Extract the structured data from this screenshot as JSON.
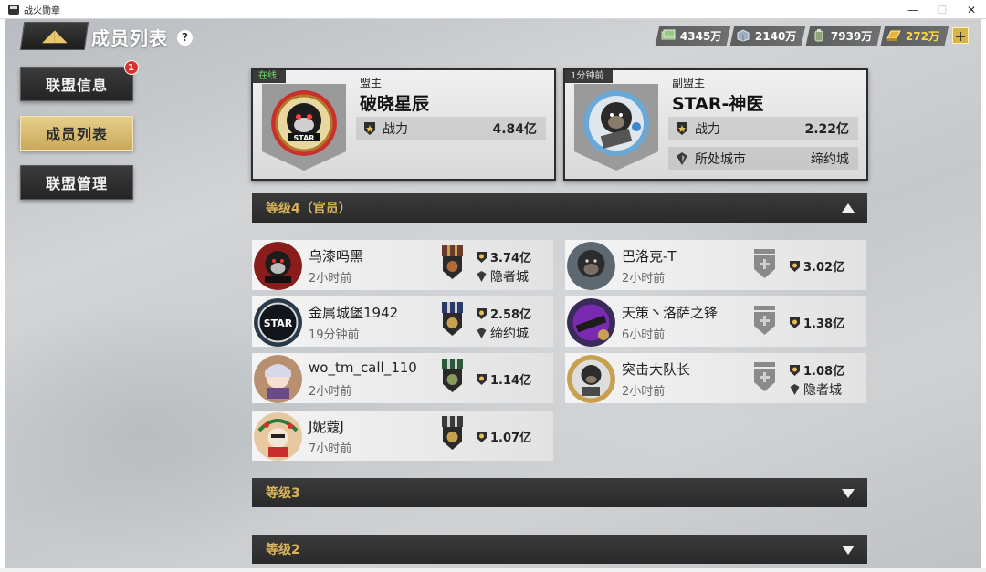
{
  "window": {
    "title": "战火勋章",
    "controls": [
      "—",
      "☐",
      "✕"
    ]
  },
  "header": {
    "back_label": "◢◣",
    "title": "成员列表",
    "help": "?"
  },
  "resources": [
    {
      "icon": "cash-icon",
      "value": "4345万",
      "color": "#7fb36a"
    },
    {
      "icon": "steel-icon",
      "value": "2140万",
      "color": "#9fb0c0"
    },
    {
      "icon": "oil-icon",
      "value": "7939万",
      "color": "#8fa47a"
    },
    {
      "icon": "gold-icon",
      "value": "272万",
      "color": "#e6b53a"
    }
  ],
  "plus_label": "+",
  "sidebar": {
    "items": [
      {
        "label": "联盟信息",
        "badge": "1"
      },
      {
        "label": "成员列表",
        "active": true
      },
      {
        "label": "联盟管理"
      }
    ]
  },
  "leaders": [
    {
      "tag": "在线",
      "role": "盟主",
      "name": "破晓星辰",
      "power_label": "战力",
      "power": "4.84亿"
    },
    {
      "tag": "1分钟前",
      "role": "副盟主",
      "name": "STAR-神医",
      "power_label": "战力",
      "power": "2.22亿",
      "city_label": "所处城市",
      "city": "缔约城"
    }
  ],
  "sections": [
    {
      "title": "等级4（官员）",
      "expanded": true
    },
    {
      "title": "等级3",
      "expanded": false
    },
    {
      "title": "等级2",
      "expanded": false
    }
  ],
  "members": [
    {
      "name": "乌漆吗黑",
      "time": "2小时前",
      "power": "3.74亿",
      "city": "隐者城"
    },
    {
      "name": "巴洛克-T",
      "time": "2小时前",
      "power": "3.02亿",
      "city": ""
    },
    {
      "name": "金属城堡1942",
      "time": "19分钟前",
      "power": "2.58亿",
      "city": "缔约城"
    },
    {
      "name": "天策丶洛萨之锋",
      "time": "6小时前",
      "power": "1.38亿",
      "city": ""
    },
    {
      "name": "wo_tm_call_110",
      "time": "2小时前",
      "power": "1.14亿",
      "city": ""
    },
    {
      "name": "突击大队长",
      "time": "2小时前",
      "power": "1.08亿",
      "city": "隐者城"
    },
    {
      "name": "J妮蔻J",
      "time": "7小时前",
      "power": "1.07亿",
      "city": ""
    }
  ]
}
